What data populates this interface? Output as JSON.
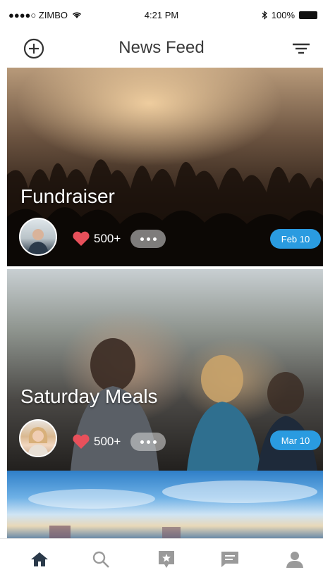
{
  "status_bar": {
    "carrier": "●●●●○ ZIMBO",
    "time": "4:21 PM",
    "battery": "100%"
  },
  "header": {
    "title": "News Feed",
    "add_icon": "plus-circle-icon",
    "filter_icon": "filter-icon"
  },
  "feed": [
    {
      "title": "Fundraiser",
      "likes": "500+",
      "date": "Feb 10"
    },
    {
      "title": "Saturday Meals",
      "likes": "500+",
      "date": "Mar 10"
    }
  ],
  "tab_bar": {
    "items": [
      "home-icon",
      "search-icon",
      "new-post-icon",
      "messages-icon",
      "profile-icon"
    ],
    "active_index": 0
  },
  "colors": {
    "accent": "#2a9be0",
    "heart": "#e8505b",
    "active_tab": "#2b3a4a",
    "inactive_tab": "#9a9a9a"
  }
}
